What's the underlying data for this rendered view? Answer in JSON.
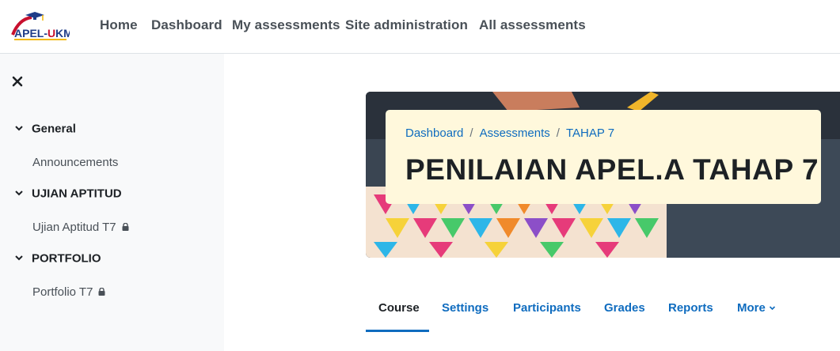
{
  "brand": {
    "logo_text": "APEL-UKM"
  },
  "navbar": {
    "items": [
      {
        "label": "Home"
      },
      {
        "label": "Dashboard"
      },
      {
        "label": "My assessments"
      },
      {
        "label": "Site administration"
      },
      {
        "label": "All assessments"
      }
    ]
  },
  "drawer": {
    "close_icon": "close-icon",
    "sections": [
      {
        "label": "General",
        "items": [
          {
            "label": "Announcements",
            "locked": false
          }
        ]
      },
      {
        "label": "UJIAN APTITUD",
        "items": [
          {
            "label": "Ujian Aptitud T7",
            "locked": true
          }
        ]
      },
      {
        "label": "PORTFOLIO",
        "items": [
          {
            "label": "Portfolio T7",
            "locked": true
          }
        ]
      }
    ]
  },
  "header": {
    "breadcrumb": [
      {
        "label": "Dashboard"
      },
      {
        "label": "Assessments"
      },
      {
        "label": "TAHAP 7"
      }
    ],
    "title": "PENILAIAN APEL.A TAHAP 7"
  },
  "secondary_nav": {
    "tabs": [
      {
        "label": "Course",
        "active": true
      },
      {
        "label": "Settings",
        "active": false
      },
      {
        "label": "Participants",
        "active": false
      },
      {
        "label": "Grades",
        "active": false
      },
      {
        "label": "Reports",
        "active": false
      },
      {
        "label": "More",
        "active": false
      }
    ]
  },
  "colors": {
    "link": "#0f6cbf",
    "header_card": "#fff8dc",
    "drawer_bg": "#f8f9fa"
  }
}
